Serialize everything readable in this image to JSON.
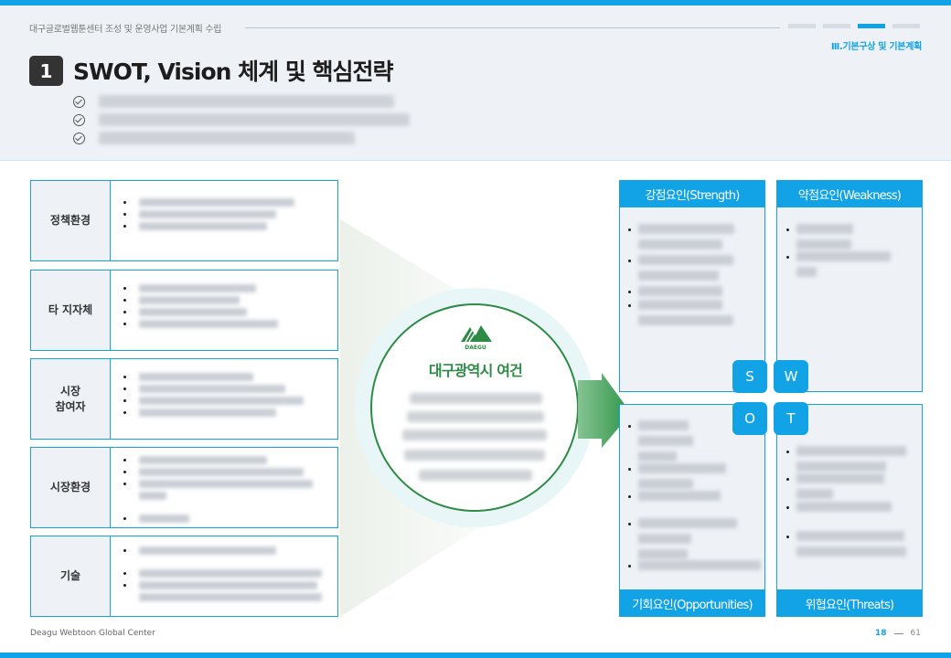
{
  "header": {
    "doc_title": "대구글로벌웹툰센터 조성 및 운영사업 기본계획 수립",
    "section_label": "Ⅲ.기본구상 및 기본계획",
    "section_number": "1",
    "title": "SWOT, Vision 체계 및 핵심전략"
  },
  "factors": [
    {
      "label": "정책환경"
    },
    {
      "label": "타 지자체"
    },
    {
      "label": "시장\n참여자"
    },
    {
      "label": "시장환경"
    },
    {
      "label": "기술"
    }
  ],
  "center": {
    "logo_text": "DAEGU",
    "title": "대구광역시 여건"
  },
  "swot": {
    "strength": "강점요인(Strength)",
    "weakness": "약점요인(Weakness)",
    "opportunities": "기회요인(Opportunities)",
    "threats": "위협요인(Threats)",
    "letters": [
      "S",
      "W",
      "O",
      "T"
    ]
  },
  "footer": {
    "left": "Deagu Webtoon Global Center",
    "page_current": "18",
    "page_total": "61"
  },
  "colors": {
    "accent": "#12a3e6",
    "green": "#2e8b45",
    "panel": "#eef2f6"
  }
}
